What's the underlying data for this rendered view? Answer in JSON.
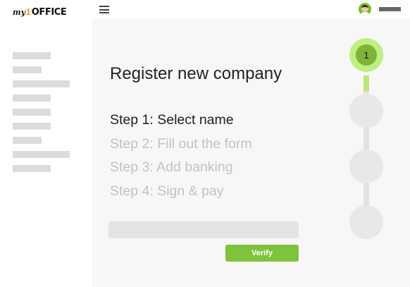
{
  "brand": {
    "logo_my": "my",
    "logo_one": "1",
    "logo_office": "OFFICE"
  },
  "sidebar": {
    "items": [
      {
        "w": 54
      },
      {
        "w": 41
      },
      {
        "w": 81
      },
      {
        "w": 54
      },
      {
        "w": 54
      },
      {
        "w": 54
      },
      {
        "w": 41
      },
      {
        "w": 81
      },
      {
        "w": 54
      }
    ]
  },
  "main": {
    "title": "Register new company",
    "steps": [
      "Step 1: Select name",
      "Step 2: Fill out the form",
      "Step 3: Add banking",
      "Step 4: Sign & pay"
    ],
    "verify_label": "Verify"
  },
  "progress": {
    "current_step": 1,
    "current_label": "1",
    "total_steps": 4
  },
  "colors": {
    "accent": "#7dc33b",
    "progress_ring": "#bfef83",
    "progress_core": "#7fb43b"
  }
}
